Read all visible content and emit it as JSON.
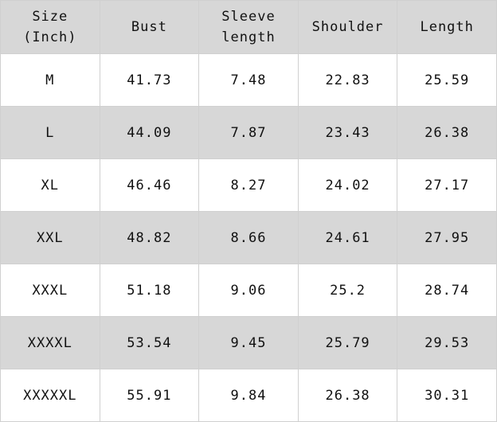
{
  "colors": {
    "header_bg": "#d7d7d7",
    "alt_row_bg": "#d7d7d7",
    "row_bg": "#ffffff"
  },
  "headers": [
    "Size\n(Inch)",
    "Bust",
    "Sleeve\nlength",
    "Shoulder",
    "Length"
  ],
  "header_lines": [
    [
      "Size",
      "(Inch)"
    ],
    [
      "Bust"
    ],
    [
      "Sleeve",
      "length"
    ],
    [
      "Shoulder"
    ],
    [
      "Length"
    ]
  ],
  "rows": [
    [
      "M",
      "41.73",
      "7.48",
      "22.83",
      "25.59"
    ],
    [
      "L",
      "44.09",
      "7.87",
      "23.43",
      "26.38"
    ],
    [
      "XL",
      "46.46",
      "8.27",
      "24.02",
      "27.17"
    ],
    [
      "XXL",
      "48.82",
      "8.66",
      "24.61",
      "27.95"
    ],
    [
      "XXXL",
      "51.18",
      "9.06",
      "25.2",
      "28.74"
    ],
    [
      "XXXXL",
      "53.54",
      "9.45",
      "25.79",
      "29.53"
    ],
    [
      "XXXXXL",
      "55.91",
      "9.84",
      "26.38",
      "30.31"
    ]
  ]
}
